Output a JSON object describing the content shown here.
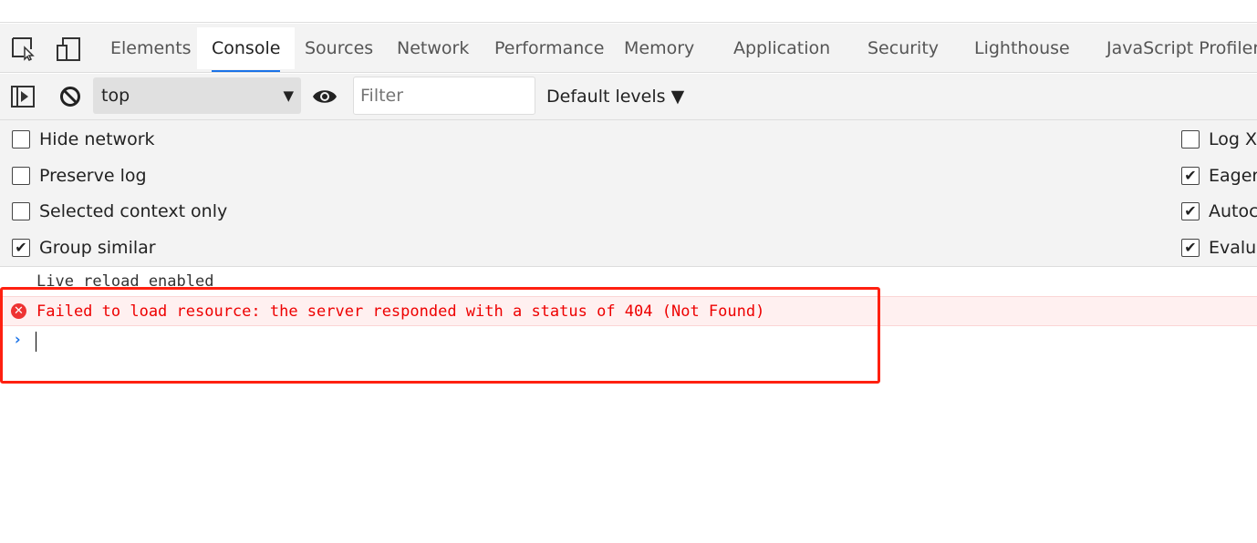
{
  "tabs": [
    {
      "label": "Elements"
    },
    {
      "label": "Console",
      "active": true
    },
    {
      "label": "Sources"
    },
    {
      "label": "Network"
    },
    {
      "label": "Performance"
    },
    {
      "label": "Memory"
    },
    {
      "label": "Application"
    },
    {
      "label": "Security"
    },
    {
      "label": "Lighthouse"
    },
    {
      "label": "JavaScript Profiler"
    }
  ],
  "toolbar": {
    "context": "top",
    "filter_placeholder": "Filter",
    "levels": "Default levels ▼"
  },
  "settings": {
    "left": [
      {
        "label": "Hide network",
        "checked": false
      },
      {
        "label": "Preserve log",
        "checked": false
      },
      {
        "label": "Selected context only",
        "checked": false
      },
      {
        "label": "Group similar",
        "checked": true
      }
    ],
    "right": [
      {
        "label": "Log XM",
        "checked": false
      },
      {
        "label": "Eager",
        "checked": true
      },
      {
        "label": "Autoco",
        "checked": true
      },
      {
        "label": "Evalua",
        "checked": true
      }
    ]
  },
  "console": {
    "info": "Live reload enabled",
    "error": "Failed to load resource: the server responded with a status of 404 (Not Found)",
    "prompt": "›"
  },
  "colors": {
    "error": "#e00000",
    "accent": "#1a73e8",
    "highlight": "#ff2010"
  }
}
